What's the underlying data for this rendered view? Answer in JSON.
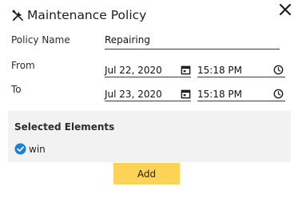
{
  "dialog": {
    "title": "Maintenance Policy",
    "title_icon": "tools-icon",
    "close_icon": "close-icon"
  },
  "form": {
    "policy_name_label": "Policy Name",
    "policy_name_value": "Repairing",
    "from_label": "From",
    "from_date": "Jul 22, 2020",
    "from_time": "15:18 PM",
    "to_label": "To",
    "to_date": "Jul 23, 2020",
    "to_time": "15:18 PM",
    "date_icon": "calendar-icon",
    "time_icon": "clock-icon"
  },
  "selected": {
    "title": "Selected Elements",
    "items": [
      {
        "label": "win",
        "checked": true
      }
    ]
  },
  "actions": {
    "add_label": "Add"
  },
  "colors": {
    "accent_button": "#fcd257",
    "check_blue": "#1e7fd6",
    "panel_bg": "#f2f2f2"
  }
}
